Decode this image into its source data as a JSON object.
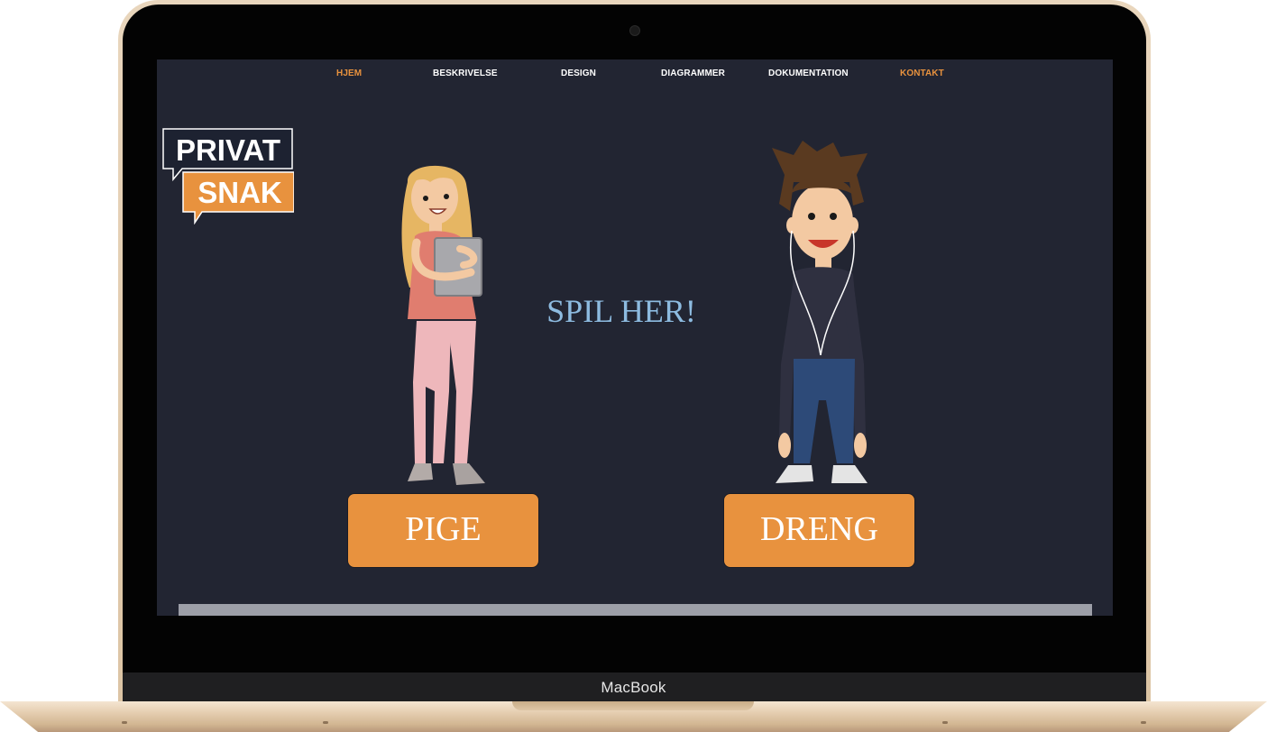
{
  "device": {
    "brand": "MacBook"
  },
  "nav": {
    "items": [
      {
        "label": "HJEM",
        "active": true
      },
      {
        "label": "BESKRIVELSE",
        "active": false
      },
      {
        "label": "DESIGN",
        "active": false
      },
      {
        "label": "DIAGRAMMER",
        "active": false
      },
      {
        "label": "DOKUMENTATION",
        "active": false
      },
      {
        "label": "KONTAKT",
        "active": true
      }
    ]
  },
  "logo": {
    "line1": "PRIVAT",
    "line2": "SNAK"
  },
  "main": {
    "play_text": "SPIL HER!",
    "girl_button": "PIGE",
    "boy_button": "DRENG"
  },
  "colors": {
    "accent": "#e8923e",
    "screen_bg": "#222532",
    "play_text": "#8dbbe0",
    "laptop_gold": "#e1cbae"
  }
}
